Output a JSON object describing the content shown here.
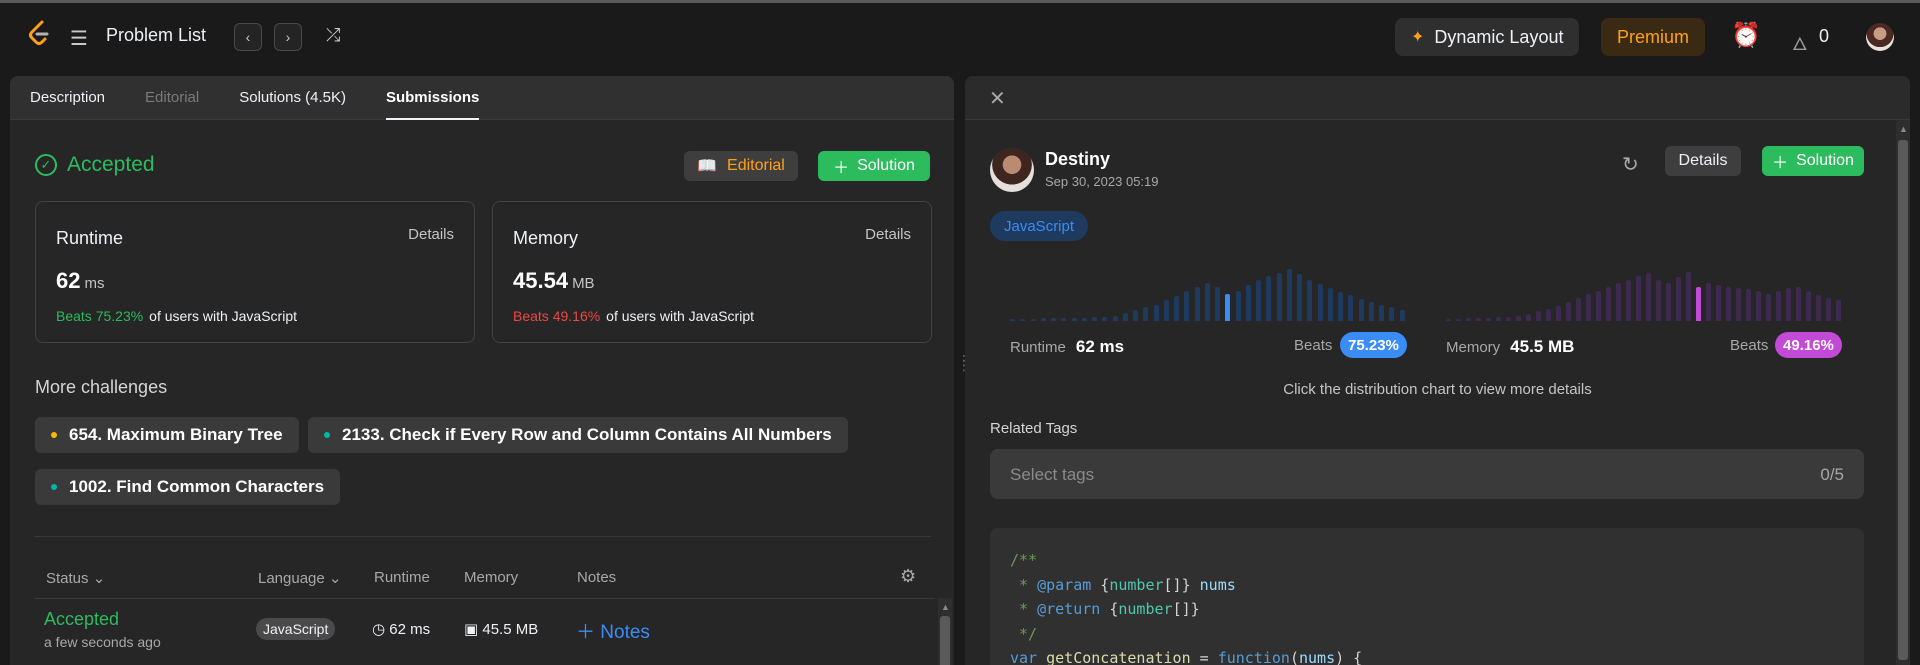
{
  "topbar": {
    "title": "Problem List",
    "prev_icon": "‹",
    "next_icon": "›",
    "shuffle_icon": "⤮",
    "dynamic_layout": "Dynamic Layout",
    "premium": "Premium",
    "streak_count": "0"
  },
  "tabs": [
    {
      "label": "Description",
      "state": "normal"
    },
    {
      "label": "Editorial",
      "state": "disabled"
    },
    {
      "label": "Solutions (4.5K)",
      "state": "normal"
    },
    {
      "label": "Submissions",
      "state": "active"
    }
  ],
  "result": {
    "status": "Accepted",
    "editorial_btn": "Editorial",
    "solution_btn": "Solution"
  },
  "runtime_card": {
    "label": "Runtime",
    "details": "Details",
    "value": "62",
    "unit": "ms",
    "beats": "Beats 75.23%",
    "suffix": "of users with JavaScript"
  },
  "memory_card": {
    "label": "Memory",
    "details": "Details",
    "value": "45.54",
    "unit": "MB",
    "beats": "Beats 49.16%",
    "suffix": "of users with JavaScript"
  },
  "more_challenges": {
    "title": "More challenges",
    "items": [
      {
        "label": "654. Maximum Binary Tree",
        "dot_color": "#ffb800"
      },
      {
        "label": "2133. Check if Every Row and Column Contains All Numbers",
        "dot_color": "#00b8a3"
      },
      {
        "label": "1002. Find Common Characters",
        "dot_color": "#00b8a3"
      }
    ]
  },
  "submissions_table": {
    "headers": {
      "status": "Status",
      "language": "Language",
      "runtime": "Runtime",
      "memory": "Memory",
      "notes": "Notes"
    },
    "rows": [
      {
        "status": "Accepted",
        "time": "a few seconds ago",
        "language": "JavaScript",
        "runtime": "62 ms",
        "memory": "45.5 MB",
        "notes": "Notes"
      }
    ]
  },
  "detail": {
    "user": "Destiny",
    "date": "Sep 30, 2023 05:19",
    "details_btn": "Details",
    "solution_btn": "Solution",
    "language": "JavaScript",
    "runtime_label": "Runtime",
    "runtime_value": "62 ms",
    "runtime_beats_label": "Beats",
    "runtime_beats": "75.23%",
    "memory_label": "Memory",
    "memory_value": "45.5 MB",
    "memory_beats_label": "Beats",
    "memory_beats": "49.16%",
    "hint": "Click the distribution chart to view more details",
    "related_tags": "Related Tags",
    "tag_placeholder": "Select tags",
    "tag_count": "0/5"
  },
  "distributions": {
    "runtime": {
      "color": "#1e3a5f",
      "highlight_color": "#3a8cf6",
      "highlight_index": 21,
      "levels": [
        0.04,
        0.04,
        0.04,
        0.05,
        0.05,
        0.05,
        0.06,
        0.06,
        0.07,
        0.08,
        0.1,
        0.14,
        0.2,
        0.25,
        0.3,
        0.38,
        0.45,
        0.55,
        0.62,
        0.7,
        0.62,
        0.5,
        0.55,
        0.65,
        0.75,
        0.82,
        0.88,
        0.95,
        0.85,
        0.75,
        0.68,
        0.6,
        0.52,
        0.48,
        0.4,
        0.35,
        0.3,
        0.25,
        0.2
      ]
    },
    "memory": {
      "color": "#3d2a4e",
      "highlight_color": "#c24ad6",
      "highlight_index": 25,
      "levels": [
        0.04,
        0.04,
        0.05,
        0.05,
        0.06,
        0.07,
        0.08,
        0.1,
        0.13,
        0.18,
        0.22,
        0.28,
        0.35,
        0.42,
        0.5,
        0.55,
        0.62,
        0.7,
        0.75,
        0.82,
        0.88,
        0.75,
        0.7,
        0.8,
        0.9,
        0.62,
        0.7,
        0.65,
        0.62,
        0.6,
        0.58,
        0.55,
        0.5,
        0.55,
        0.6,
        0.62,
        0.55,
        0.48,
        0.42,
        0.38
      ]
    }
  },
  "code": [
    [
      [
        "c-com",
        "/**"
      ]
    ],
    [
      [
        "c-com",
        " * "
      ],
      [
        "c-tag",
        "@param"
      ],
      [
        "c-plain",
        " {"
      ],
      [
        "c-type",
        "number"
      ],
      [
        "c-plain",
        "[]} "
      ],
      [
        "c-param",
        "nums"
      ]
    ],
    [
      [
        "c-com",
        " * "
      ],
      [
        "c-tag",
        "@return"
      ],
      [
        "c-plain",
        " {"
      ],
      [
        "c-type",
        "number"
      ],
      [
        "c-plain",
        "[]}"
      ]
    ],
    [
      [
        "c-com",
        " */"
      ]
    ],
    [
      [
        "c-kw",
        "var"
      ],
      [
        "c-plain",
        " "
      ],
      [
        "c-fn",
        "getConcatenation"
      ],
      [
        "c-plain",
        " = "
      ],
      [
        "c-kw",
        "function"
      ],
      [
        "c-plain",
        "("
      ],
      [
        "c-param",
        "nums"
      ],
      [
        "c-plain",
        ") {"
      ]
    ]
  ]
}
